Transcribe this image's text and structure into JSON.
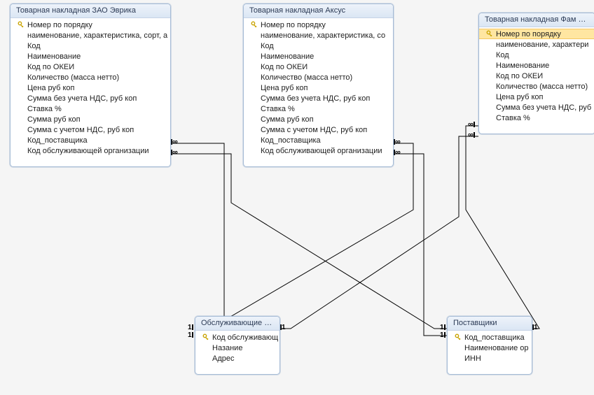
{
  "tables": {
    "evrika": {
      "title": "Товарная накладная ЗАО Эврика",
      "fields": [
        {
          "label": "Номер по порядку",
          "pk": true
        },
        {
          "label": "наименование, характеристика, сорт, а",
          "pk": false
        },
        {
          "label": "Код",
          "pk": false
        },
        {
          "label": "Наименование",
          "pk": false
        },
        {
          "label": "Код по ОКЕИ",
          "pk": false
        },
        {
          "label": "Количество (масса нетто)",
          "pk": false
        },
        {
          "label": "Цена руб коп",
          "pk": false
        },
        {
          "label": "Сумма без учета НДС, руб коп",
          "pk": false
        },
        {
          "label": "Ставка %",
          "pk": false
        },
        {
          "label": "Сумма руб коп",
          "pk": false
        },
        {
          "label": "Сумма с учетом НДС, руб коп",
          "pk": false
        },
        {
          "label": "Код_поставщика",
          "pk": false
        },
        {
          "label": "Код обслуживающей организации",
          "pk": false
        }
      ]
    },
    "aksus": {
      "title": "Товарная накладная Аксус",
      "fields": [
        {
          "label": "Номер по порядку",
          "pk": true
        },
        {
          "label": "наименование, характеристика, со",
          "pk": false
        },
        {
          "label": "Код",
          "pk": false
        },
        {
          "label": "Наименование",
          "pk": false
        },
        {
          "label": "Код по ОКЕИ",
          "pk": false
        },
        {
          "label": "Количество (масса нетто)",
          "pk": false
        },
        {
          "label": "Цена руб коп",
          "pk": false
        },
        {
          "label": "Сумма без учета НДС, руб коп",
          "pk": false
        },
        {
          "label": "Ставка %",
          "pk": false
        },
        {
          "label": "Сумма руб коп",
          "pk": false
        },
        {
          "label": "Сумма с учетом НДС, руб коп",
          "pk": false
        },
        {
          "label": "Код_поставщика",
          "pk": false
        },
        {
          "label": "Код обслуживающей организации",
          "pk": false
        }
      ]
    },
    "fam": {
      "title": "Товарная накладная Фам копи",
      "fields": [
        {
          "label": "Номер по порядку",
          "pk": true,
          "selected": true
        },
        {
          "label": "наименование, характери",
          "pk": false
        },
        {
          "label": "Код",
          "pk": false
        },
        {
          "label": "Наименование",
          "pk": false
        },
        {
          "label": "Код по ОКЕИ",
          "pk": false
        },
        {
          "label": "Количество (масса нетто)",
          "pk": false
        },
        {
          "label": "Цена руб коп",
          "pk": false
        },
        {
          "label": "Сумма без учета НДС, руб",
          "pk": false
        },
        {
          "label": "Ставка %",
          "pk": false
        }
      ]
    },
    "service": {
      "title": "Обслуживающие о...",
      "fields": [
        {
          "label": "Код обслуживающ",
          "pk": true
        },
        {
          "label": "Назание",
          "pk": false
        },
        {
          "label": "Адрес",
          "pk": false
        }
      ]
    },
    "suppliers": {
      "title": "Поставщики",
      "fields": [
        {
          "label": "Код_поставщика",
          "pk": true
        },
        {
          "label": "Наименование ор",
          "pk": false
        },
        {
          "label": "ИНН",
          "pk": false
        }
      ]
    }
  },
  "relationships": [
    {
      "from": "evrika",
      "to": "service",
      "fromSide": "right",
      "toSide": "left",
      "many": "from"
    },
    {
      "from": "evrika",
      "to": "suppliers",
      "fromSide": "right",
      "toSide": "left",
      "many": "from"
    },
    {
      "from": "aksus",
      "to": "service",
      "fromSide": "right",
      "toSide": "left",
      "many": "from"
    },
    {
      "from": "aksus",
      "to": "suppliers",
      "fromSide": "right",
      "toSide": "left",
      "many": "from"
    },
    {
      "from": "fam",
      "to": "service",
      "fromSide": "left",
      "toSide": "right",
      "many": "from"
    },
    {
      "from": "fam",
      "to": "suppliers",
      "fromSide": "left",
      "toSide": "right",
      "many": "from"
    }
  ],
  "glyphs": {
    "infinity": "∞",
    "one": "1"
  }
}
